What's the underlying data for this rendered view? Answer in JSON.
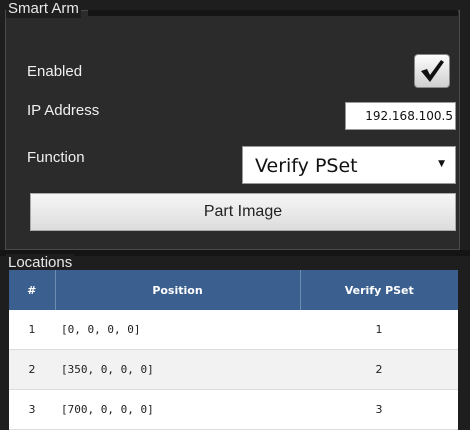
{
  "smart_arm": {
    "title": "Smart Arm",
    "enabled_label": "Enabled",
    "enabled": true,
    "ip_label": "IP Address",
    "ip_value": "192.168.100.5",
    "function_label": "Function",
    "function_value": "Verify PSet",
    "part_image_label": "Part Image"
  },
  "locations": {
    "title": "Locations",
    "headers": [
      "#",
      "Position",
      "Verify PSet"
    ],
    "rows": [
      {
        "index": "1",
        "position": "[0, 0, 0, 0]",
        "pset": "1"
      },
      {
        "index": "2",
        "position": "[350, 0, 0, 0]",
        "pset": "2"
      },
      {
        "index": "3",
        "position": "[700, 0, 0, 0]",
        "pset": "3"
      }
    ]
  },
  "colors": {
    "header_bg": "#3b5f8f",
    "panel_bg": "#2b2b2b"
  }
}
